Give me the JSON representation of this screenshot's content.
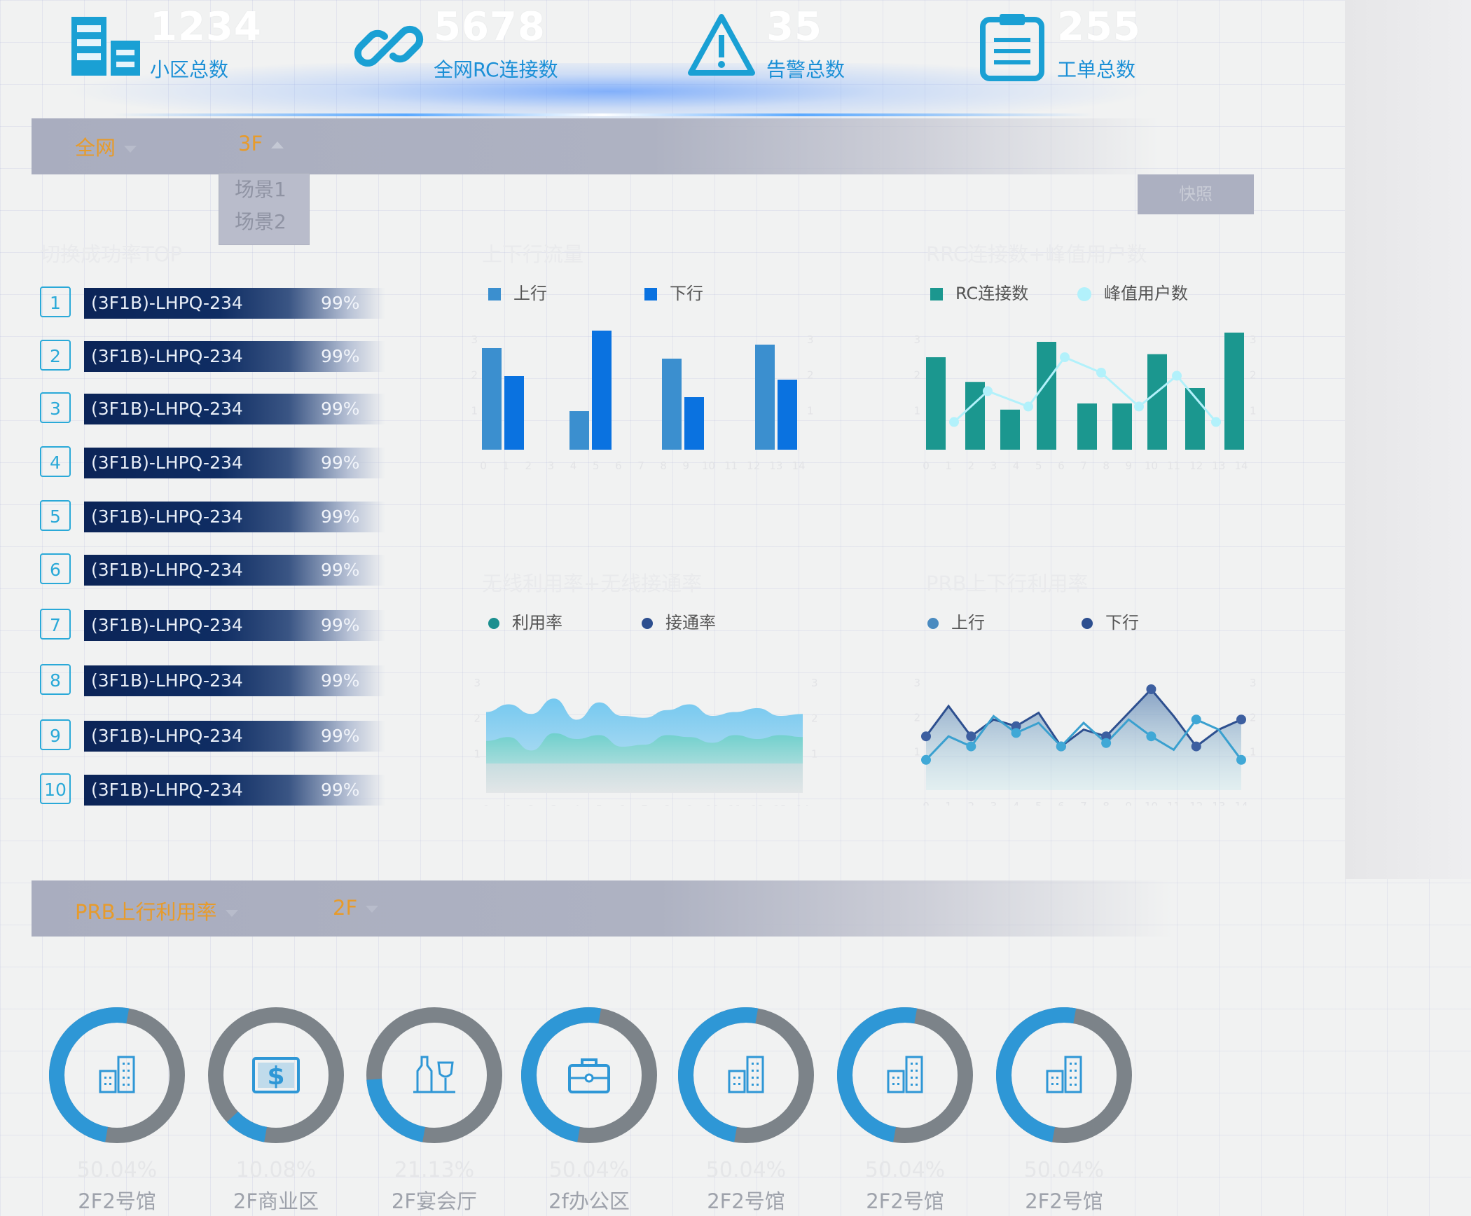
{
  "kpis": [
    {
      "value": "1234",
      "label": "小区总数",
      "icon": "building-icon"
    },
    {
      "value": "5678",
      "label": "全网RC连接数",
      "icon": "link-icon"
    },
    {
      "value": "35",
      "label": "告警总数",
      "icon": "warning-icon"
    },
    {
      "value": "255",
      "label": "工单总数",
      "icon": "clipboard-icon"
    }
  ],
  "filters": {
    "network": "全网",
    "floor": "3F",
    "floor_options": [
      "场景1",
      "场景2"
    ],
    "snapshot_button": "快照"
  },
  "sections": {
    "handover_top": "切换成功率TOP",
    "traffic": "上下行流量",
    "rrc": "RRC连接数+峰值用户数",
    "wireless": "无线利用率+无线接通率",
    "prb": "PRB上下行利用率"
  },
  "ranking": [
    {
      "rank": "1",
      "name": "(3F1B)-LHPQ-234",
      "value": "99%"
    },
    {
      "rank": "2",
      "name": "(3F1B)-LHPQ-234",
      "value": "99%"
    },
    {
      "rank": "3",
      "name": "(3F1B)-LHPQ-234",
      "value": "99%"
    },
    {
      "rank": "4",
      "name": "(3F1B)-LHPQ-234",
      "value": "99%"
    },
    {
      "rank": "5",
      "name": "(3F1B)-LHPQ-234",
      "value": "99%"
    },
    {
      "rank": "6",
      "name": "(3F1B)-LHPQ-234",
      "value": "99%"
    },
    {
      "rank": "7",
      "name": "(3F1B)-LHPQ-234",
      "value": "99%"
    },
    {
      "rank": "8",
      "name": "(3F1B)-LHPQ-234",
      "value": "99%"
    },
    {
      "rank": "9",
      "name": "(3F1B)-LHPQ-234",
      "value": "99%"
    },
    {
      "rank": "10",
      "name": "(3F1B)-LHPQ-234",
      "value": "99%"
    }
  ],
  "chart_data": [
    {
      "type": "bar",
      "x_ticks": [
        "0",
        "1",
        "2",
        "3",
        "4",
        "5",
        "6",
        "7",
        "8",
        "9",
        "10",
        "11",
        "12",
        "13",
        "14"
      ],
      "y_ticks": [
        "1",
        "2",
        "3"
      ],
      "series": [
        {
          "name": "上行",
          "color": "#3b8fcf",
          "values": [
            2.9,
            1.1,
            2.6,
            3.0
          ]
        },
        {
          "name": "下行",
          "color": "#0a72e0",
          "values": [
            2.1,
            3.4,
            1.5,
            2.0
          ]
        }
      ]
    },
    {
      "type": "bar",
      "x_ticks": [
        "0",
        "1",
        "2",
        "3",
        "4",
        "5",
        "6",
        "7",
        "8",
        "9",
        "10",
        "11",
        "12",
        "13",
        "14"
      ],
      "y_ticks": [
        "1",
        "2",
        "3"
      ],
      "series": [
        {
          "name": "RC连接数",
          "color": "#1b978f",
          "values": [
            3.0,
            2.2,
            1.3,
            3.5,
            1.5,
            1.5,
            3.1,
            2.0,
            3.8
          ]
        },
        {
          "name": "峰值用户数",
          "color": "#b2f1fb",
          "values": [
            0.9,
            1.9,
            1.4,
            3.0,
            2.5,
            1.4,
            2.4,
            0.9
          ]
        }
      ]
    },
    {
      "type": "area",
      "x_ticks": [
        "0",
        "1",
        "2",
        "3",
        "4",
        "5",
        "6",
        "7",
        "8",
        "9",
        "10",
        "11",
        "12",
        "13",
        "14"
      ],
      "y_ticks": [
        "1",
        "2",
        "3"
      ],
      "series": [
        {
          "name": "利用率",
          "color": "#1b8f8f",
          "values": [
            1.35,
            1.45,
            1.1,
            1.55,
            1.4,
            1.5,
            1.2,
            1.25,
            1.5,
            1.45,
            1.3,
            1.5,
            1.4,
            1.5,
            1.45
          ]
        },
        {
          "name": "接通率",
          "color": "#2d4f8f",
          "values": [
            2.1,
            2.3,
            2.05,
            2.45,
            1.9,
            2.35,
            2.0,
            1.95,
            2.15,
            2.3,
            2.0,
            2.1,
            2.2,
            2.0,
            2.05
          ]
        }
      ]
    },
    {
      "type": "line",
      "x_ticks": [
        "0",
        "1",
        "2",
        "3",
        "4",
        "5",
        "6",
        "7",
        "8",
        "9",
        "10",
        "11",
        "12",
        "13",
        "14"
      ],
      "y_ticks": [
        "1",
        "2",
        "3"
      ],
      "series": [
        {
          "name": "上行",
          "color": "#4a8bc0",
          "values": [
            0.9,
            1.6,
            1.3,
            2.2,
            1.7,
            2.0,
            1.3,
            2.0,
            1.4,
            2.1,
            1.6,
            1.2,
            2.1,
            1.8,
            0.9
          ]
        },
        {
          "name": "下行",
          "color": "#2d4f8f",
          "values": [
            1.6,
            2.5,
            1.6,
            2.1,
            1.9,
            2.3,
            1.3,
            1.8,
            1.6,
            2.3,
            3.0,
            2.2,
            1.3,
            1.8,
            2.1
          ]
        }
      ]
    }
  ],
  "bottom": {
    "metric": "PRB上行利用率",
    "floor": "2F",
    "donuts": [
      {
        "pct": "50.04%",
        "name": "2F2号馆",
        "icon": "office-building-icon",
        "fraction": 0.5004
      },
      {
        "pct": "10.08%",
        "name": "2F商业区",
        "icon": "dollar-sign-icon",
        "fraction": 0.1008
      },
      {
        "pct": "21.13%",
        "name": "2F宴会厅",
        "icon": "wine-glass-icon",
        "fraction": 0.2113
      },
      {
        "pct": "50.04%",
        "name": "2f办公区",
        "icon": "briefcase-icon",
        "fraction": 0.5004
      },
      {
        "pct": "50.04%",
        "name": "2F2号馆",
        "icon": "office-building-icon",
        "fraction": 0.5004
      },
      {
        "pct": "50.04%",
        "name": "2F2号馆",
        "icon": "office-building-icon",
        "fraction": 0.5004
      },
      {
        "pct": "50.04%",
        "name": "2F2号馆",
        "icon": "office-building-icon",
        "fraction": 0.5004
      }
    ]
  },
  "colors": {
    "accent": "#1a8fd6",
    "orange": "#e79b2b",
    "navy": "#0b2457",
    "teal": "#1b978f",
    "donut_track": "#7c8389",
    "donut_fill": "#2e97d6"
  }
}
